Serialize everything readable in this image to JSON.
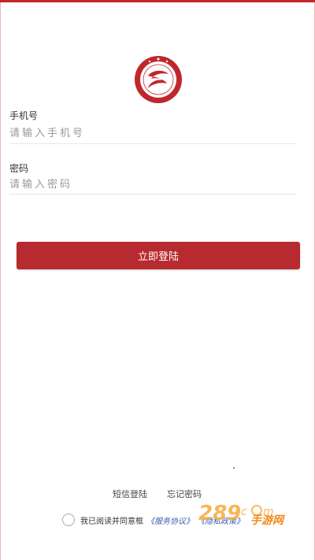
{
  "form": {
    "phone_label": "手机号",
    "phone_placeholder": "请输入手机号",
    "password_label": "密码",
    "password_placeholder": "请输入密码",
    "login_button": "立即登陆"
  },
  "links": {
    "sms_login": "短信登陆",
    "forgot_password": "忘记密码"
  },
  "agreement": {
    "text": "我已阅读并同意框",
    "service_link": "《服务协议》",
    "privacy_link": "《隐私政策》"
  },
  "watermark": {
    "site": "手游网"
  },
  "colors": {
    "accent": "#b72a2f",
    "link": "#3a5bb0"
  },
  "icons": {
    "logo": "red-circular-emblem-icon",
    "agree": "radio-unchecked-icon"
  }
}
